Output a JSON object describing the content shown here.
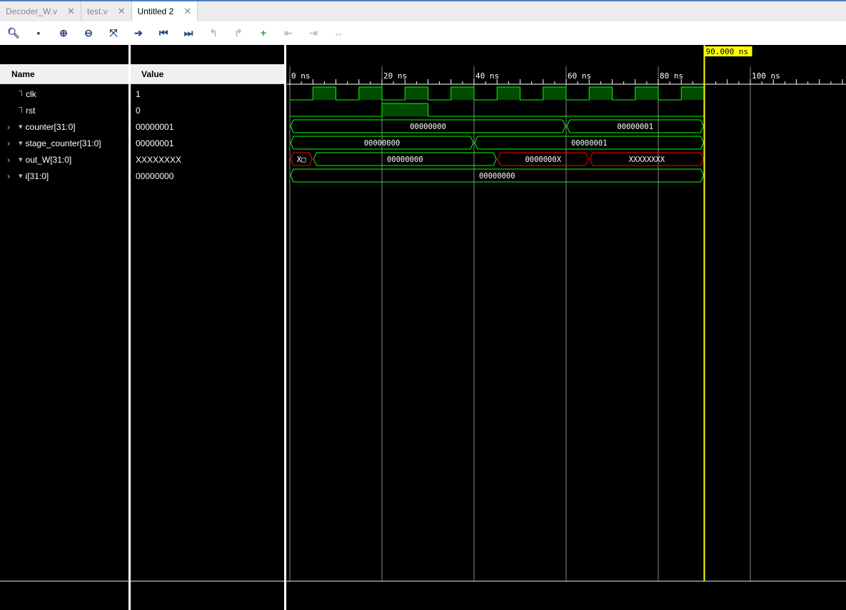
{
  "tabs": [
    {
      "label": "Decoder_W.v",
      "active": false
    },
    {
      "label": "test.v",
      "active": false
    },
    {
      "label": "Untitled 2",
      "active": true
    }
  ],
  "toolbar": [
    {
      "name": "search-icon",
      "glyph": "🔍︎",
      "enabled": true
    },
    {
      "name": "save-icon",
      "glyph": "▪",
      "enabled": true
    },
    {
      "name": "zoom-in-icon",
      "glyph": "⊕",
      "enabled": true
    },
    {
      "name": "zoom-out-icon",
      "glyph": "⊖",
      "enabled": true
    },
    {
      "name": "zoom-fit-icon",
      "glyph": "⤧",
      "enabled": true
    },
    {
      "name": "go-to-cursor-icon",
      "glyph": "➔",
      "enabled": true
    },
    {
      "name": "go-to-start-icon",
      "glyph": "⏮",
      "enabled": true
    },
    {
      "name": "go-to-end-icon",
      "glyph": "⏭",
      "enabled": true
    },
    {
      "name": "previous-transition-icon",
      "glyph": "↰",
      "enabled": false
    },
    {
      "name": "next-transition-icon",
      "glyph": "↱",
      "enabled": false
    },
    {
      "name": "add-marker-icon",
      "glyph": "+",
      "enabled": true
    },
    {
      "name": "previous-marker-icon",
      "glyph": "⇤",
      "enabled": false
    },
    {
      "name": "next-marker-icon",
      "glyph": "⇥",
      "enabled": false
    },
    {
      "name": "swap-cursors-icon",
      "glyph": "↔",
      "enabled": false
    }
  ],
  "headers": {
    "name": "Name",
    "value": "Value"
  },
  "signals": [
    {
      "name": "clk",
      "value": "1",
      "type": "bit",
      "expandable": false
    },
    {
      "name": "rst",
      "value": "0",
      "type": "bit",
      "expandable": false
    },
    {
      "name": "counter[31:0]",
      "value": "00000001",
      "type": "bus",
      "expandable": true,
      "segments": [
        [
          0,
          60,
          "00000000",
          "valid"
        ],
        [
          60,
          90,
          "00000001",
          "valid"
        ]
      ]
    },
    {
      "name": "stage_counter[31:0]",
      "value": "00000001",
      "type": "bus",
      "expandable": true,
      "segments": [
        [
          0,
          40,
          "00000000",
          "valid"
        ],
        [
          40,
          90,
          "00000001",
          "valid"
        ]
      ]
    },
    {
      "name": "out_W[31:0]",
      "value": "XXXXXXXX",
      "type": "bus",
      "expandable": true,
      "segments": [
        [
          0,
          5,
          "X□",
          "unknown"
        ],
        [
          5,
          45,
          "00000000",
          "valid"
        ],
        [
          45,
          65,
          "0000000X",
          "unknown"
        ],
        [
          65,
          90,
          "XXXXXXXX",
          "unknown"
        ]
      ]
    },
    {
      "name": "i[31:0]",
      "value": "00000000",
      "type": "bus",
      "expandable": true,
      "segments": [
        [
          0,
          90,
          "00000000",
          "valid"
        ]
      ]
    }
  ],
  "clk": {
    "period_ns": 10,
    "first_rise_ns": 5
  },
  "rst": {
    "high_ns": [
      20,
      30
    ]
  },
  "ruler": {
    "labels": [
      "0 ns",
      "20 ns",
      "40 ns",
      "60 ns",
      "80 ns",
      "100 ns"
    ],
    "major_ns": [
      0,
      20,
      40,
      60,
      80,
      100
    ]
  },
  "cursor": {
    "time_ns": 90,
    "label": "90.000 ns"
  },
  "sim_end_ns": 90,
  "colors": {
    "valid": "#00ff00",
    "unknown": "#ff0000",
    "fill": "#004d00",
    "cursor": "#ffff00"
  }
}
